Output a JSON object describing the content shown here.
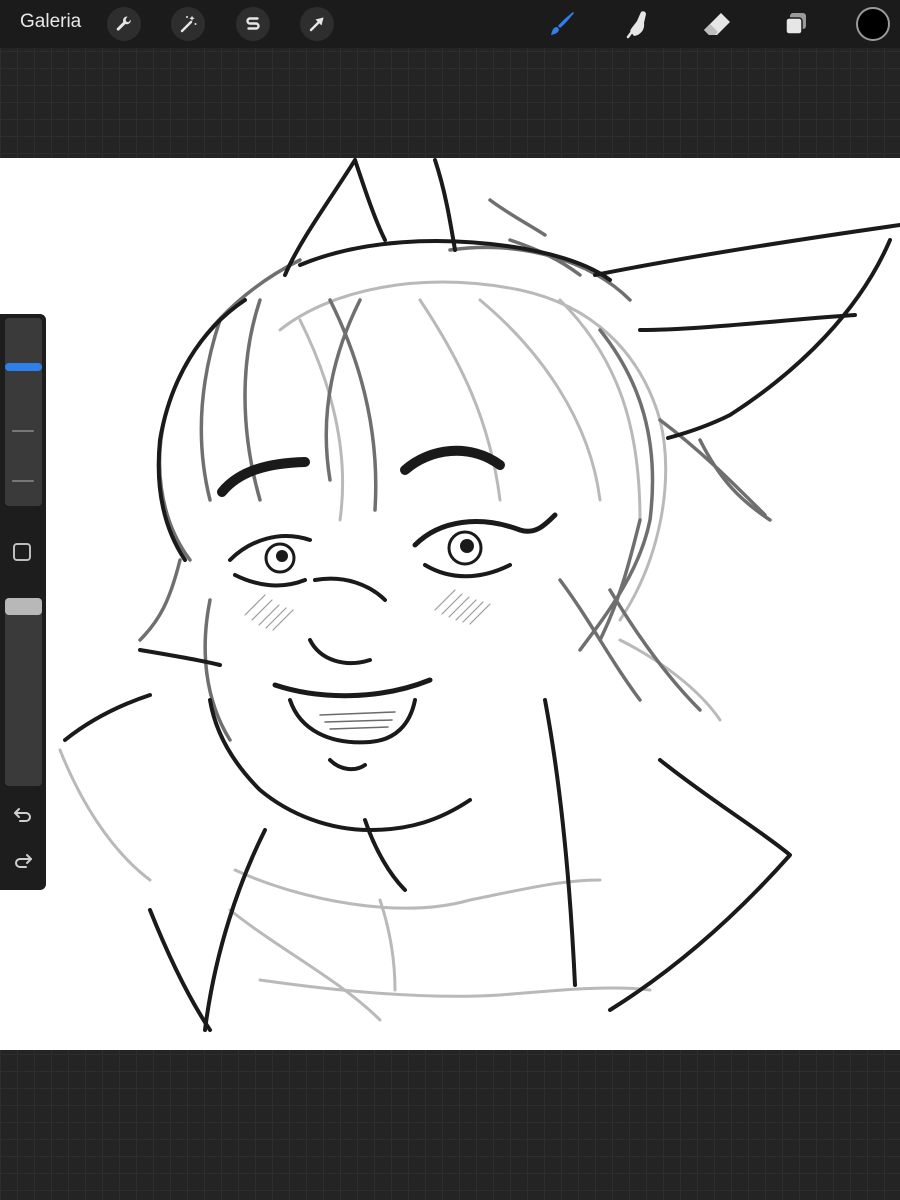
{
  "topbar": {
    "gallery_label": "Galeria",
    "left_tools": [
      {
        "name": "actions",
        "icon": "wrench-icon"
      },
      {
        "name": "adjustments",
        "icon": "magic-wand-icon"
      },
      {
        "name": "selection",
        "icon": "selection-s-icon"
      },
      {
        "name": "transform",
        "icon": "arrow-cursor-icon"
      }
    ],
    "right_tools": [
      {
        "name": "brush",
        "icon": "brush-icon",
        "active": true
      },
      {
        "name": "smudge",
        "icon": "smudge-finger-icon",
        "active": false
      },
      {
        "name": "eraser",
        "icon": "eraser-icon",
        "active": false
      },
      {
        "name": "layers",
        "icon": "layers-icon",
        "active": false
      }
    ],
    "current_color": "#000000"
  },
  "sidebar": {
    "brush_size_level": 0.75,
    "opacity_level": 0.0,
    "modify_icon": "square-modify-icon",
    "undo_icon": "undo-arrow-icon",
    "redo_icon": "redo-arrow-icon"
  },
  "colors": {
    "accent": "#2f7fea",
    "toolbar_bg": "#1b1b1b",
    "workspace_bg": "#242424",
    "canvas_bg": "#ffffff"
  }
}
